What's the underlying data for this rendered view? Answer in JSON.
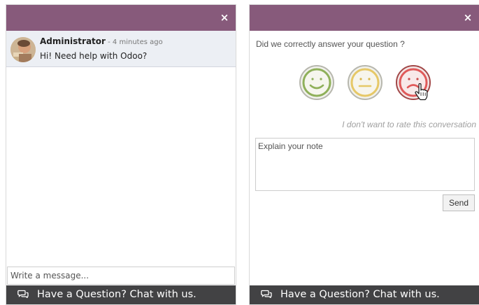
{
  "left_chat": {
    "close_label": "×",
    "message": {
      "author": "Administrator",
      "time": " - 4 minutes ago",
      "text": "Hi! Need help with Odoo?"
    },
    "composer_placeholder": "Write a message..."
  },
  "rating_chat": {
    "close_label": "×",
    "question": "Did we correctly answer your question ?",
    "faces": [
      "happy-face-icon",
      "neutral-face-icon",
      "sad-face-icon"
    ],
    "skip_label": "I don't want to rate this conversation",
    "note_placeholder": "Explain your note",
    "send_label": "Send"
  },
  "footer": {
    "label": "Have a Question? Chat with us."
  },
  "colors": {
    "header": "#875a7b",
    "footer": "#424244",
    "message_bg": "#eceff4",
    "happy": "#8fb05a",
    "neutral": "#e6c867",
    "sad": "#e05a5a"
  }
}
